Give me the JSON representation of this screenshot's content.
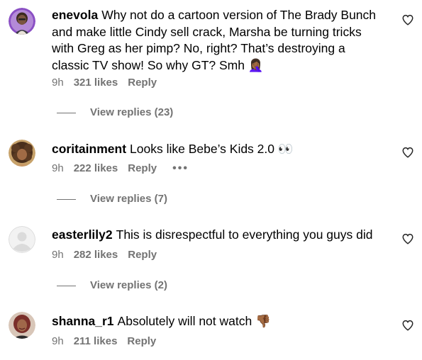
{
  "comments": [
    {
      "username": "enevola",
      "text": "Why not do a cartoon version of The Brady Bunch and make little Cindy sell crack, Marsha be turning tricks with Greg as her pimp? No, right? That’s destroying a classic TV show! So why GT? Smh 🤦🏾‍♀️",
      "time": "9h",
      "likes": "321 likes",
      "reply": "Reply",
      "view_replies": "View replies (23)",
      "avatar": "avatar-woman-purple"
    },
    {
      "username": "coritainment",
      "text": "Looks like Bebe’s Kids 2.0 👀",
      "time": "9h",
      "likes": "222 likes",
      "reply": "Reply",
      "more": "•••",
      "view_replies": "View replies (7)",
      "avatar": "avatar-curly-hair"
    },
    {
      "username": "easterlily2",
      "text": "This is disrespectful to everything you guys did",
      "time": "9h",
      "likes": "282 likes",
      "reply": "Reply",
      "view_replies": "View replies (2)",
      "avatar": "avatar-default-gray"
    },
    {
      "username": "shanna_r1",
      "text": "Absolutely will not watch 👎🏾",
      "time": "9h",
      "likes": "211 likes",
      "reply": "Reply",
      "avatar": "avatar-woman-red"
    }
  ],
  "icons": {
    "like": "heart-outline-icon"
  },
  "colors": {
    "meta_gray": "#737373",
    "text": "#000000",
    "background": "#ffffff"
  }
}
